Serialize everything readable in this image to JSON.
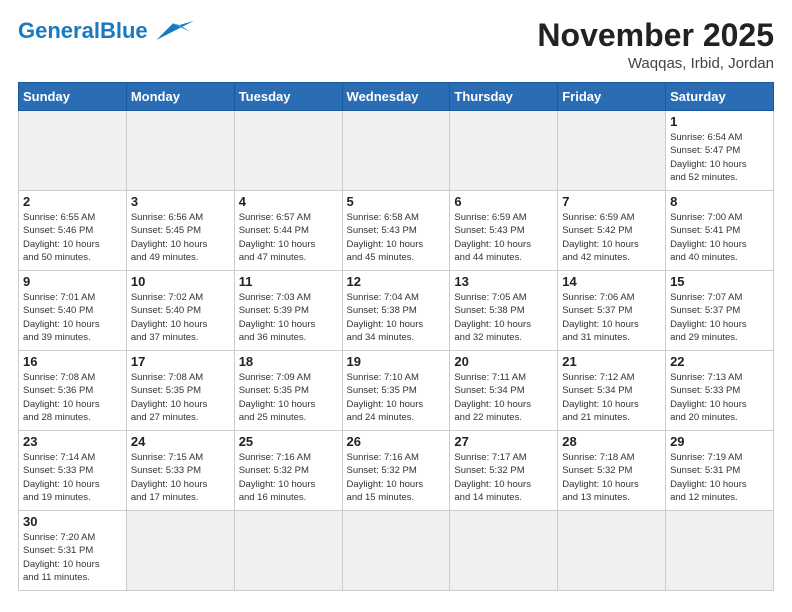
{
  "header": {
    "logo_general": "General",
    "logo_blue": "Blue",
    "month_title": "November 2025",
    "location": "Waqqas, Irbid, Jordan"
  },
  "weekdays": [
    "Sunday",
    "Monday",
    "Tuesday",
    "Wednesday",
    "Thursday",
    "Friday",
    "Saturday"
  ],
  "days": [
    {
      "num": "",
      "info": "",
      "empty": true
    },
    {
      "num": "",
      "info": "",
      "empty": true
    },
    {
      "num": "",
      "info": "",
      "empty": true
    },
    {
      "num": "",
      "info": "",
      "empty": true
    },
    {
      "num": "",
      "info": "",
      "empty": true
    },
    {
      "num": "",
      "info": "",
      "empty": true
    },
    {
      "num": "1",
      "info": "Sunrise: 6:54 AM\nSunset: 5:47 PM\nDaylight: 10 hours\nand 52 minutes."
    },
    {
      "num": "2",
      "info": "Sunrise: 6:55 AM\nSunset: 5:46 PM\nDaylight: 10 hours\nand 50 minutes."
    },
    {
      "num": "3",
      "info": "Sunrise: 6:56 AM\nSunset: 5:45 PM\nDaylight: 10 hours\nand 49 minutes."
    },
    {
      "num": "4",
      "info": "Sunrise: 6:57 AM\nSunset: 5:44 PM\nDaylight: 10 hours\nand 47 minutes."
    },
    {
      "num": "5",
      "info": "Sunrise: 6:58 AM\nSunset: 5:43 PM\nDaylight: 10 hours\nand 45 minutes."
    },
    {
      "num": "6",
      "info": "Sunrise: 6:59 AM\nSunset: 5:43 PM\nDaylight: 10 hours\nand 44 minutes."
    },
    {
      "num": "7",
      "info": "Sunrise: 6:59 AM\nSunset: 5:42 PM\nDaylight: 10 hours\nand 42 minutes."
    },
    {
      "num": "8",
      "info": "Sunrise: 7:00 AM\nSunset: 5:41 PM\nDaylight: 10 hours\nand 40 minutes."
    },
    {
      "num": "9",
      "info": "Sunrise: 7:01 AM\nSunset: 5:40 PM\nDaylight: 10 hours\nand 39 minutes."
    },
    {
      "num": "10",
      "info": "Sunrise: 7:02 AM\nSunset: 5:40 PM\nDaylight: 10 hours\nand 37 minutes."
    },
    {
      "num": "11",
      "info": "Sunrise: 7:03 AM\nSunset: 5:39 PM\nDaylight: 10 hours\nand 36 minutes."
    },
    {
      "num": "12",
      "info": "Sunrise: 7:04 AM\nSunset: 5:38 PM\nDaylight: 10 hours\nand 34 minutes."
    },
    {
      "num": "13",
      "info": "Sunrise: 7:05 AM\nSunset: 5:38 PM\nDaylight: 10 hours\nand 32 minutes."
    },
    {
      "num": "14",
      "info": "Sunrise: 7:06 AM\nSunset: 5:37 PM\nDaylight: 10 hours\nand 31 minutes."
    },
    {
      "num": "15",
      "info": "Sunrise: 7:07 AM\nSunset: 5:37 PM\nDaylight: 10 hours\nand 29 minutes."
    },
    {
      "num": "16",
      "info": "Sunrise: 7:08 AM\nSunset: 5:36 PM\nDaylight: 10 hours\nand 28 minutes."
    },
    {
      "num": "17",
      "info": "Sunrise: 7:08 AM\nSunset: 5:35 PM\nDaylight: 10 hours\nand 27 minutes."
    },
    {
      "num": "18",
      "info": "Sunrise: 7:09 AM\nSunset: 5:35 PM\nDaylight: 10 hours\nand 25 minutes."
    },
    {
      "num": "19",
      "info": "Sunrise: 7:10 AM\nSunset: 5:35 PM\nDaylight: 10 hours\nand 24 minutes."
    },
    {
      "num": "20",
      "info": "Sunrise: 7:11 AM\nSunset: 5:34 PM\nDaylight: 10 hours\nand 22 minutes."
    },
    {
      "num": "21",
      "info": "Sunrise: 7:12 AM\nSunset: 5:34 PM\nDaylight: 10 hours\nand 21 minutes."
    },
    {
      "num": "22",
      "info": "Sunrise: 7:13 AM\nSunset: 5:33 PM\nDaylight: 10 hours\nand 20 minutes."
    },
    {
      "num": "23",
      "info": "Sunrise: 7:14 AM\nSunset: 5:33 PM\nDaylight: 10 hours\nand 19 minutes."
    },
    {
      "num": "24",
      "info": "Sunrise: 7:15 AM\nSunset: 5:33 PM\nDaylight: 10 hours\nand 17 minutes."
    },
    {
      "num": "25",
      "info": "Sunrise: 7:16 AM\nSunset: 5:32 PM\nDaylight: 10 hours\nand 16 minutes."
    },
    {
      "num": "26",
      "info": "Sunrise: 7:16 AM\nSunset: 5:32 PM\nDaylight: 10 hours\nand 15 minutes."
    },
    {
      "num": "27",
      "info": "Sunrise: 7:17 AM\nSunset: 5:32 PM\nDaylight: 10 hours\nand 14 minutes."
    },
    {
      "num": "28",
      "info": "Sunrise: 7:18 AM\nSunset: 5:32 PM\nDaylight: 10 hours\nand 13 minutes."
    },
    {
      "num": "29",
      "info": "Sunrise: 7:19 AM\nSunset: 5:31 PM\nDaylight: 10 hours\nand 12 minutes."
    },
    {
      "num": "30",
      "info": "Sunrise: 7:20 AM\nSunset: 5:31 PM\nDaylight: 10 hours\nand 11 minutes."
    },
    {
      "num": "",
      "info": "",
      "empty": true
    },
    {
      "num": "",
      "info": "",
      "empty": true
    },
    {
      "num": "",
      "info": "",
      "empty": true
    },
    {
      "num": "",
      "info": "",
      "empty": true
    },
    {
      "num": "",
      "info": "",
      "empty": true
    },
    {
      "num": "",
      "info": "",
      "empty": true
    }
  ]
}
